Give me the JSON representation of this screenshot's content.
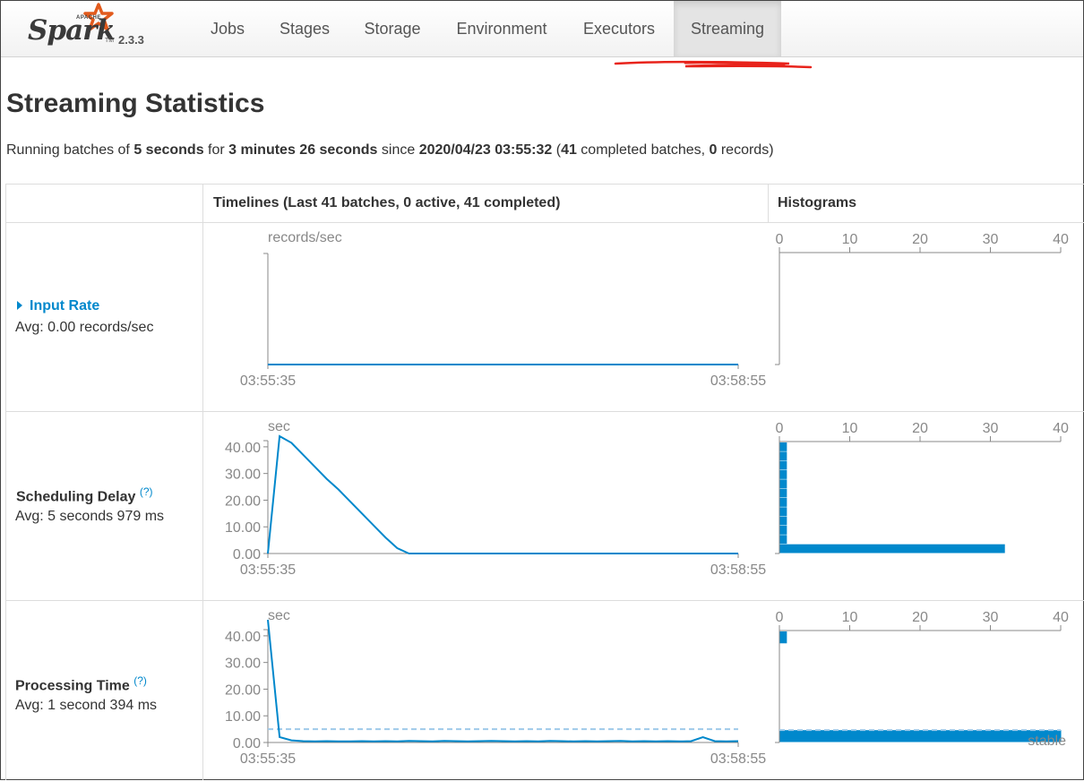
{
  "brand": {
    "apache": "APACHE",
    "name": "Spark",
    "tm": "TM",
    "version": "2.3.3"
  },
  "nav": {
    "tabs": [
      {
        "label": "Jobs"
      },
      {
        "label": "Stages"
      },
      {
        "label": "Storage"
      },
      {
        "label": "Environment"
      },
      {
        "label": "Executors"
      },
      {
        "label": "Streaming",
        "active": true
      }
    ]
  },
  "page": {
    "title": "Streaming Statistics"
  },
  "summary": {
    "t1": "Running batches of ",
    "batch_interval": "5 seconds",
    "t2": " for ",
    "duration": "3 minutes 26 seconds",
    "t3": " since ",
    "start_time": "2020/04/23 03:55:32",
    "t4": " (",
    "completed_batches": "41",
    "t5": " completed batches, ",
    "records": "0",
    "t6": " records)"
  },
  "table": {
    "col_timelines": "Timelines (Last 41 batches, 0 active, 41 completed)",
    "col_histograms": "Histograms"
  },
  "colors": {
    "accent": "#0088cc",
    "line": "#0088cc",
    "axis": "#888888",
    "dash": "#9fc9ea"
  },
  "metrics": [
    {
      "title": "Input Rate",
      "avg": "Avg: 0.00 records/sec",
      "help": "",
      "icon": "caret-right-icon"
    },
    {
      "title": "Scheduling Delay",
      "avg": "Avg: 5 seconds 979 ms",
      "help": "(?)"
    },
    {
      "title": "Processing Time",
      "avg": "Avg: 1 second 394 ms",
      "help": "(?)"
    }
  ],
  "chart_data": [
    {
      "type": "line",
      "ylabel": "records/sec",
      "x_tick_labels": [
        "03:55:35",
        "03:58:55"
      ],
      "y_ticks": [],
      "ylim": [
        0,
        1
      ],
      "x_count": 41,
      "values": [
        0,
        0,
        0,
        0,
        0,
        0,
        0,
        0,
        0,
        0,
        0,
        0,
        0,
        0,
        0,
        0,
        0,
        0,
        0,
        0,
        0,
        0,
        0,
        0,
        0,
        0,
        0,
        0,
        0,
        0,
        0,
        0,
        0,
        0,
        0,
        0,
        0,
        0,
        0,
        0,
        0
      ]
    },
    {
      "type": "line",
      "ylabel": "sec",
      "x_tick_labels": [
        "03:55:35",
        "03:58:55"
      ],
      "y_ticks": [
        "0.00",
        "10.00",
        "20.00",
        "30.00",
        "40.00"
      ],
      "ylim": [
        0,
        45
      ],
      "x_count": 41,
      "values": [
        0,
        44,
        41.5,
        37,
        32.5,
        28,
        24,
        19.5,
        15,
        10.5,
        6,
        2,
        0,
        0,
        0,
        0,
        0,
        0,
        0,
        0,
        0,
        0,
        0,
        0,
        0,
        0,
        0,
        0,
        0,
        0,
        0,
        0,
        0,
        0,
        0,
        0,
        0,
        0,
        0,
        0,
        0
      ]
    },
    {
      "type": "line",
      "ylabel": "sec",
      "x_tick_labels": [
        "03:55:35",
        "03:58:55"
      ],
      "y_ticks": [
        "0.00",
        "10.00",
        "20.00",
        "30.00",
        "40.00"
      ],
      "ylim": [
        0,
        45
      ],
      "x_count": 41,
      "threshold": 5,
      "values": [
        46,
        2,
        0.8,
        0.5,
        0.4,
        0.5,
        0.4,
        0.4,
        0.5,
        0.4,
        0.5,
        0.4,
        0.6,
        0.5,
        0.4,
        0.6,
        0.5,
        0.4,
        0.5,
        0.6,
        0.5,
        0.4,
        0.5,
        0.4,
        0.6,
        0.5,
        0.4,
        0.5,
        0.4,
        0.5,
        0.6,
        0.4,
        0.5,
        0.4,
        0.5,
        0.4,
        0.5,
        2,
        0.5,
        0.4,
        0.5
      ]
    },
    {
      "type": "bar",
      "orientation": "horizontal",
      "x_ticks": [
        "0",
        "10",
        "20",
        "30",
        "40"
      ],
      "xlim": [
        0,
        40
      ],
      "bins": []
    },
    {
      "type": "bar",
      "orientation": "horizontal",
      "x_ticks": [
        "0",
        "10",
        "20",
        "30",
        "40"
      ],
      "xlim": [
        0,
        40
      ],
      "bins": [
        1,
        1,
        1,
        1,
        1,
        1,
        1,
        1,
        1,
        1,
        1,
        32
      ]
    },
    {
      "type": "bar",
      "orientation": "horizontal",
      "x_ticks": [
        "0",
        "10",
        "20",
        "30",
        "40"
      ],
      "xlim": [
        0,
        40
      ],
      "threshold_label": "stable",
      "bins": [
        1,
        0,
        0,
        0,
        0,
        0,
        0,
        0,
        40
      ]
    }
  ]
}
